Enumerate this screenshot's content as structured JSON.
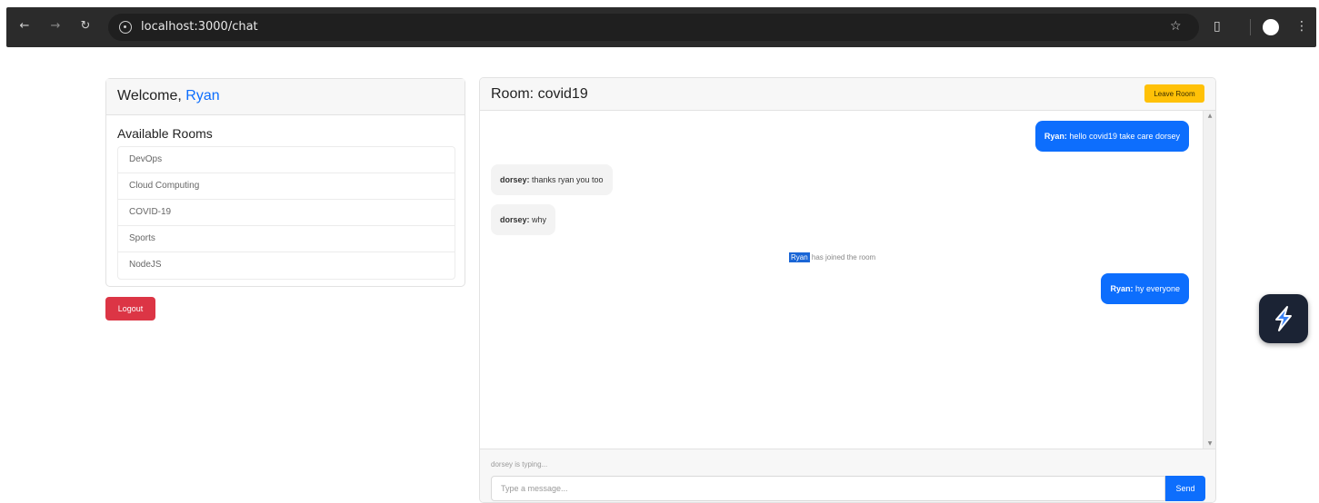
{
  "browser": {
    "url": "localhost:3000/chat",
    "back_icon": "arrow-left-icon",
    "forward_icon": "arrow-right-icon",
    "reload_icon": "reload-icon",
    "bookmark_icon": "star-icon",
    "extensions_icon": "puzzle-icon",
    "menu_icon": "kebab-menu-icon"
  },
  "sidebar": {
    "welcome_prefix": "Welcome,",
    "username": "Ryan",
    "rooms_title": "Available Rooms",
    "rooms": [
      {
        "label": "DevOps"
      },
      {
        "label": "Cloud Computing"
      },
      {
        "label": "COVID-19"
      },
      {
        "label": "Sports"
      },
      {
        "label": "NodeJS"
      }
    ],
    "logout_label": "Logout"
  },
  "chat": {
    "room_title": "Room: covid19",
    "leave_label": "Leave Room",
    "messages": [
      {
        "sender": "Ryan:",
        "text": " hello covid19 take care dorsey",
        "direction": "out"
      },
      {
        "sender": "dorsey:",
        "text": " thanks ryan you too",
        "direction": "in"
      },
      {
        "sender": "dorsey:",
        "text": " why",
        "direction": "in"
      },
      {
        "sender": "Ryan:",
        "text": " hy everyone",
        "direction": "out"
      }
    ],
    "system_message": {
      "highlight": "Ryan",
      "text": " has joined the room"
    },
    "typing_indicator": "dorsey is typing...",
    "input_placeholder": "Type a message...",
    "send_label": "Send"
  },
  "colors": {
    "primary": "#0d6efd",
    "danger": "#dc3545",
    "warning": "#ffc107"
  }
}
